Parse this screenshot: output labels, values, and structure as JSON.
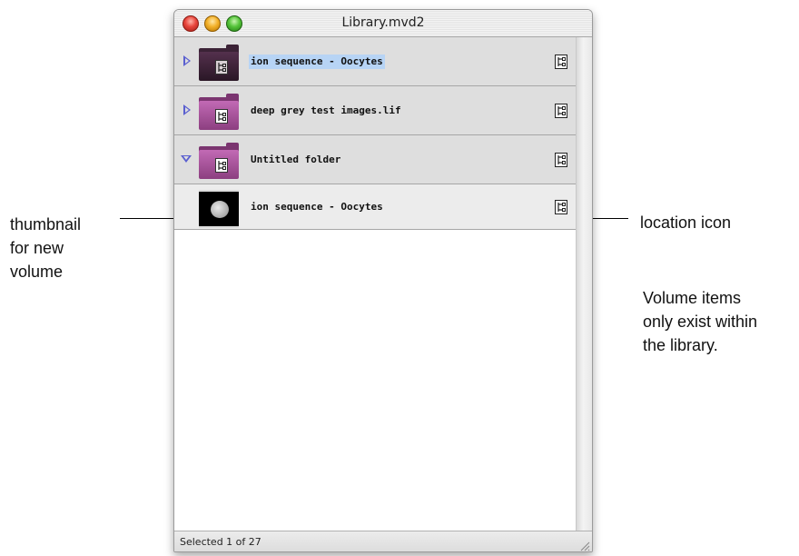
{
  "window": {
    "title": "Library.mvd2"
  },
  "rows": [
    {
      "label": "ion sequence - Oocytes",
      "expanded": false,
      "icon": "folder-icon",
      "color": "#3b2236",
      "selected": true
    },
    {
      "label": "deep grey test images.lif",
      "expanded": false,
      "icon": "folder-icon",
      "color": "#b15ea5",
      "selected": false
    },
    {
      "label": "Untitled folder",
      "expanded": true,
      "icon": "folder-icon",
      "color": "#b15ea5",
      "selected": false
    },
    {
      "label": "ion sequence - Oocytes",
      "expanded": null,
      "icon": "volume-thumbnail",
      "child": true,
      "selected": false
    }
  ],
  "status": {
    "text": "Selected 1 of 27"
  },
  "annotations": {
    "thumbnail_lines": [
      "thumbnail",
      "for new",
      "volume"
    ],
    "location_icon": "location icon",
    "volume_note_lines": [
      "Volume items",
      "only exist within",
      "the library."
    ]
  },
  "colors": {
    "selection": "#b7d4f5",
    "disclosure": "#5a5fd0",
    "row_background": "#dedede"
  }
}
